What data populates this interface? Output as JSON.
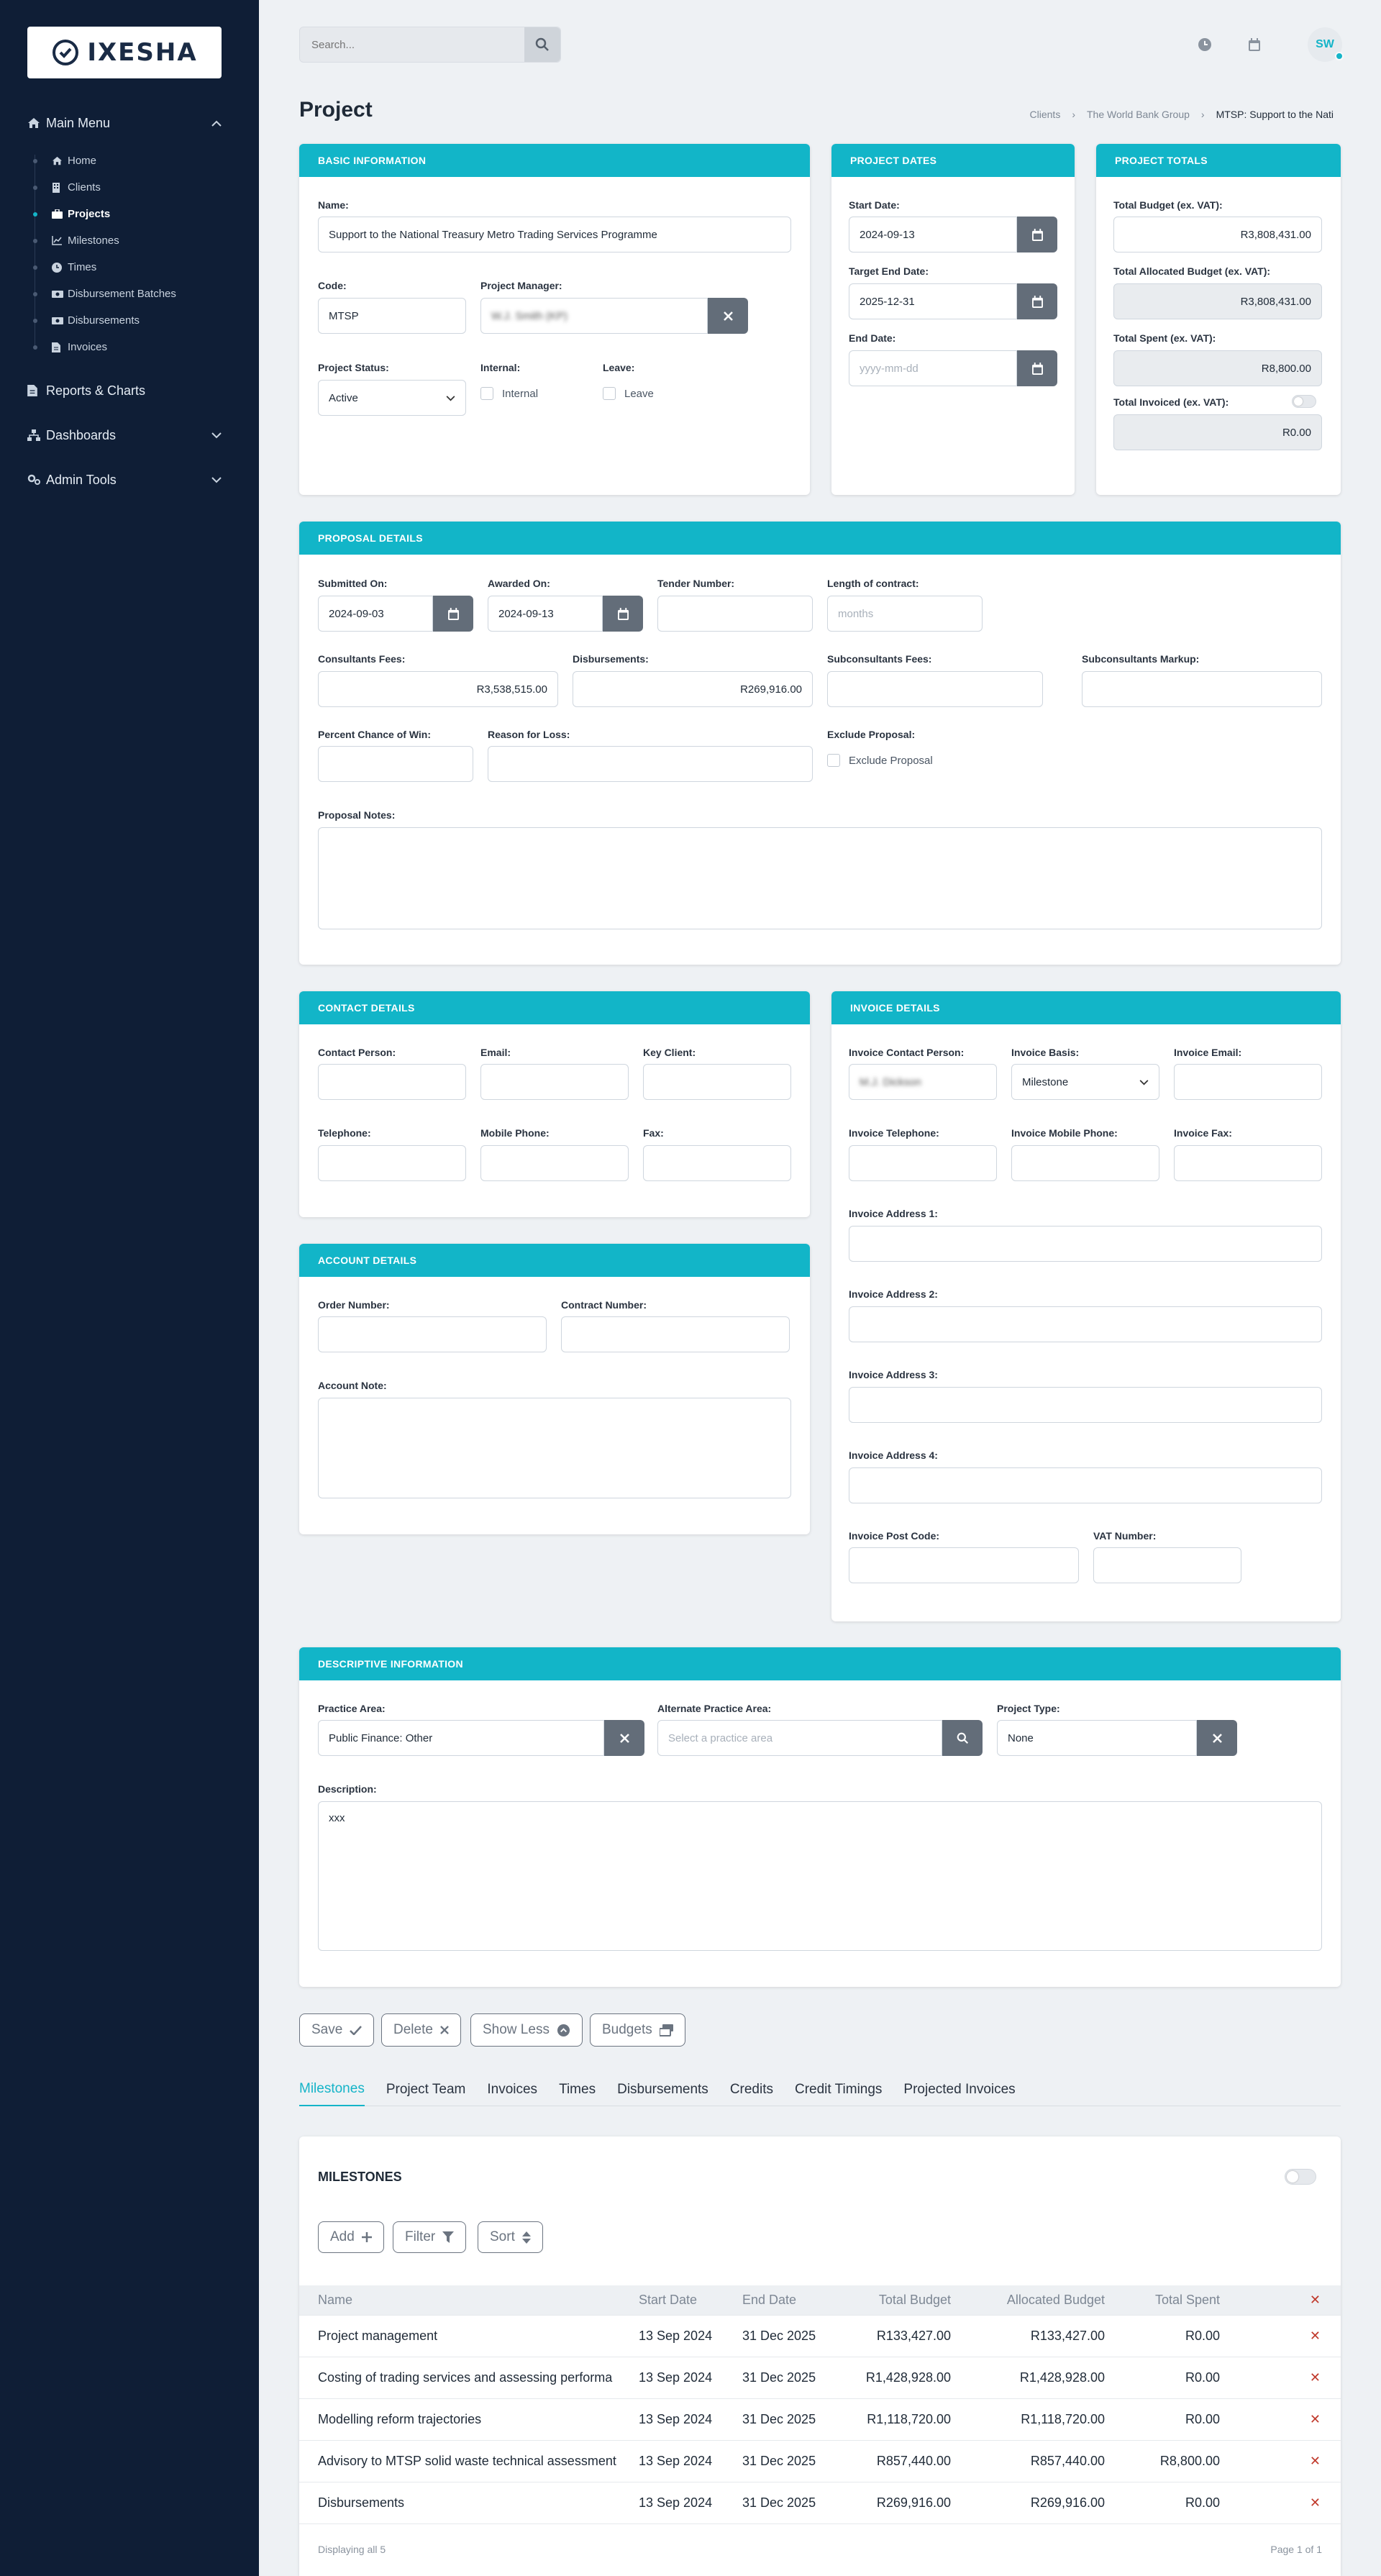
{
  "brand": {
    "name": "IXESHA"
  },
  "sidebar": {
    "main_menu": "Main Menu",
    "items": [
      {
        "label": "Home",
        "icon": "home-icon"
      },
      {
        "label": "Clients",
        "icon": "building-icon"
      },
      {
        "label": "Projects",
        "icon": "briefcase-icon",
        "active": true
      },
      {
        "label": "Milestones",
        "icon": "chart-icon"
      },
      {
        "label": "Times",
        "icon": "clock-icon"
      },
      {
        "label": "Disbursement Batches",
        "icon": "money-icon"
      },
      {
        "label": "Disbursements",
        "icon": "money-icon"
      },
      {
        "label": "Invoices",
        "icon": "document-icon"
      }
    ],
    "reports": "Reports & Charts",
    "dashboards": "Dashboards",
    "admin": "Admin Tools"
  },
  "topbar": {
    "search_placeholder": "Search...",
    "avatar": "SW"
  },
  "page": {
    "title": "Project"
  },
  "breadcrumb": {
    "items": [
      "Clients",
      "The World Bank Group"
    ],
    "current": "MTSP: Support to the Nati"
  },
  "basic": {
    "header": "BASIC INFORMATION",
    "name_label": "Name:",
    "name": "Support to the National Treasury Metro Trading Services Programme",
    "code_label": "Code:",
    "code": "MTSP",
    "pm_label": "Project Manager:",
    "pm": "W.J. Smith (KP)",
    "status_label": "Project Status:",
    "status": "Active",
    "internal_label": "Internal:",
    "internal_text": "Internal",
    "leave_label": "Leave:",
    "leave_text": "Leave"
  },
  "dates": {
    "header": "PROJECT DATES",
    "start_label": "Start Date:",
    "start": "2024-09-13",
    "target_label": "Target End Date:",
    "target": "2025-12-31",
    "end_label": "End Date:",
    "end_placeholder": "yyyy-mm-dd"
  },
  "totals": {
    "header": "PROJECT TOTALS",
    "budget_label": "Total Budget (ex. VAT):",
    "budget": "R3,808,431.00",
    "allocated_label": "Total Allocated Budget (ex. VAT):",
    "allocated": "R3,808,431.00",
    "spent_label": "Total Spent (ex. VAT):",
    "spent": "R8,800.00",
    "invoiced_label": "Total Invoiced (ex. VAT):",
    "invoiced": "R0.00"
  },
  "proposal": {
    "header": "PROPOSAL DETAILS",
    "submitted_label": "Submitted On:",
    "submitted": "2024-09-03",
    "awarded_label": "Awarded On:",
    "awarded": "2024-09-13",
    "tender_label": "Tender Number:",
    "length_label": "Length of contract:",
    "length_placeholder": "months",
    "consultants_label": "Consultants Fees:",
    "consultants": "R3,538,515.00",
    "disb_label": "Disbursements:",
    "disb": "R269,916.00",
    "subfees_label": "Subconsultants Fees:",
    "submarkup_label": "Subconsultants Markup:",
    "chance_label": "Percent Chance of Win:",
    "reason_label": "Reason for Loss:",
    "exclude_label": "Exclude Proposal:",
    "exclude_text": "Exclude Proposal",
    "notes_label": "Proposal Notes:"
  },
  "contact": {
    "header": "CONTACT DETAILS",
    "person_label": "Contact Person:",
    "email_label": "Email:",
    "key_label": "Key Client:",
    "tel_label": "Telephone:",
    "mobile_label": "Mobile Phone:",
    "fax_label": "Fax:"
  },
  "account": {
    "header": "ACCOUNT DETAILS",
    "order_label": "Order Number:",
    "contract_label": "Contract Number:",
    "note_label": "Account Note:"
  },
  "invoice": {
    "header": "INVOICE DETAILS",
    "person_label": "Invoice Contact Person:",
    "person": "M.J. Dickson",
    "basis_label": "Invoice Basis:",
    "basis": "Milestone",
    "email_label": "Invoice Email:",
    "tel_label": "Invoice Telephone:",
    "mobile_label": "Invoice Mobile Phone:",
    "fax_label": "Invoice Fax:",
    "addr1_label": "Invoice Address 1:",
    "addr2_label": "Invoice Address 2:",
    "addr3_label": "Invoice Address 3:",
    "addr4_label": "Invoice Address 4:",
    "post_label": "Invoice Post Code:",
    "vat_label": "VAT Number:"
  },
  "descriptive": {
    "header": "DESCRIPTIVE INFORMATION",
    "practice_label": "Practice Area:",
    "practice": "Public Finance: Other",
    "alt_label": "Alternate Practice Area:",
    "alt_placeholder": "Select a practice area",
    "type_label": "Project Type:",
    "type": "None",
    "desc_label": "Description:",
    "desc": "xxx"
  },
  "actions": {
    "save": "Save",
    "delete": "Delete",
    "show_less": "Show Less",
    "budgets": "Budgets"
  },
  "tabs": [
    "Milestones",
    "Project Team",
    "Invoices",
    "Times",
    "Disbursements",
    "Credits",
    "Credit Timings",
    "Projected Invoices"
  ],
  "milestones": {
    "title": "MILESTONES",
    "add": "Add",
    "filter": "Filter",
    "sort": "Sort",
    "columns": [
      "Name",
      "Start Date",
      "End Date",
      "Total Budget",
      "Allocated Budget",
      "Total Spent"
    ],
    "rows": [
      {
        "name": "Project management",
        "start": "13 Sep 2024",
        "end": "31 Dec 2025",
        "budget": "R133,427.00",
        "allocated": "R133,427.00",
        "spent": "R0.00"
      },
      {
        "name": "Costing of trading services and assessing performa",
        "start": "13 Sep 2024",
        "end": "31 Dec 2025",
        "budget": "R1,428,928.00",
        "allocated": "R1,428,928.00",
        "spent": "R0.00"
      },
      {
        "name": "Modelling reform trajectories",
        "start": "13 Sep 2024",
        "end": "31 Dec 2025",
        "budget": "R1,118,720.00",
        "allocated": "R1,118,720.00",
        "spent": "R0.00"
      },
      {
        "name": "Advisory to MTSP solid waste technical assessment",
        "start": "13 Sep 2024",
        "end": "31 Dec 2025",
        "budget": "R857,440.00",
        "allocated": "R857,440.00",
        "spent": "R8,800.00"
      },
      {
        "name": "Disbursements",
        "start": "13 Sep 2024",
        "end": "31 Dec 2025",
        "budget": "R269,916.00",
        "allocated": "R269,916.00",
        "spent": "R0.00"
      }
    ],
    "footer_left": "Displaying all 5",
    "footer_right": "Page 1 of 1"
  }
}
